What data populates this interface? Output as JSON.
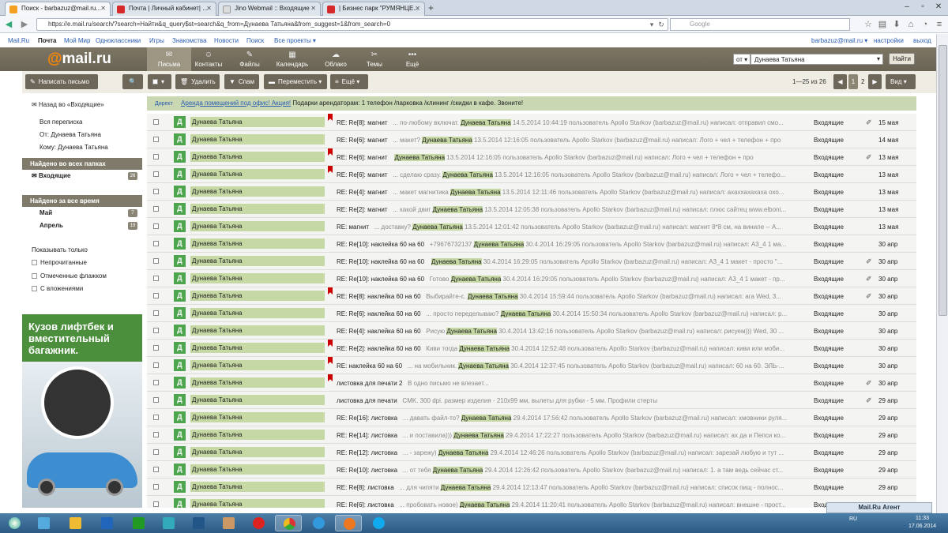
{
  "browser": {
    "tabs": [
      {
        "title": "Поиск - barbazuz@mail.ru...",
        "icon": "mailru-favicon"
      },
      {
        "title": "Почта | Личный кабинет| ...",
        "icon": "p-favicon"
      },
      {
        "title": "Jino Webmail :: Входящие",
        "icon": "jino-favicon"
      },
      {
        "title": "| Бизнес парк \"РУМЯНЦЕ...",
        "icon": "p-favicon"
      }
    ],
    "url": "https://e.mail.ru/search/?search=Найти&q_query$st=search&q_from=Дунаева Татьяна&from_suggest=1&from_search=0",
    "search_placeholder": "Google"
  },
  "toplinks": {
    "left": [
      "Mail.Ru",
      "Почта",
      "Мой Мир",
      "Одноклассники",
      "Игры",
      "Знакомства",
      "Новости",
      "Поиск",
      "Все проекты ▾"
    ],
    "account": "barbazuz@mail.ru ▾",
    "settings": "настройки",
    "logout": "выход"
  },
  "header": {
    "logo": "mail.ru",
    "nav": [
      "Письма",
      "Контакты",
      "Файлы",
      "Календарь",
      "Облако",
      "Темы",
      "Ещё"
    ],
    "search_scope": "от",
    "search_value": "Дунаева Татьяна",
    "search_button": "Найти"
  },
  "toolbar": {
    "compose": "Написать письмо",
    "delete": "Удалить",
    "spam": "Спам",
    "move": "Переместить",
    "more": "Ещё",
    "range": "1—25 из 26",
    "page1": "1",
    "page2": "2",
    "view": "Вид"
  },
  "sidebar": {
    "back": "Назад во «Входящие»",
    "links": [
      "Вся переписка",
      "От: Дунаева Татьяна",
      "Кому: Дунаева Татьяна"
    ],
    "found_all_folders": "Найдено во всех папках",
    "inbox": "Входящие",
    "inbox_count": "26",
    "found_all_time": "Найдено за все время",
    "months": [
      {
        "label": "Май",
        "count": "7"
      },
      {
        "label": "Апрель",
        "count": "19"
      }
    ],
    "show_only": "Показывать только",
    "filters": [
      "Непрочитанные",
      "Отмеченные флажком",
      "С вложениями"
    ]
  },
  "ad": {
    "headline": "Кузов лифтбек и вместительный багажник."
  },
  "direct": {
    "label": "Директ",
    "link": "Аренда помещений под офис! Акция!",
    "text": " Подарки арендаторам: 1 телефон /парковка /клининг /скидки в кафе. Звоните!"
  },
  "messages": [
    {
      "sender": "Дунаева Татьяна",
      "flag": true,
      "subject": "RE: Re[8]: магнит",
      "pre": "... по-любому включат.",
      "hl": "Дунаева Татьяна",
      "post": " 14.5.2014 10:44:19 пользователь Apollo Starkov (barbazuz@mail.ru) написал: отправил смо...",
      "folder": "Входящие",
      "clip": true,
      "date": "15 мая"
    },
    {
      "sender": "Дунаева Татьяна",
      "flag": false,
      "subject": "RE: Re[6]: магнит",
      "pre": "... макет?",
      "hl": "Дунаева Татьяна",
      "post": " 13.5.2014 12:16:05 пользователь Apollo Starkov (barbazuz@mail.ru) написал: Лого + чел + телефон + про",
      "folder": "Входящие",
      "clip": false,
      "date": "14 мая"
    },
    {
      "sender": "Дунаева Татьяна",
      "flag": true,
      "subject": "RE: Re[6]: магнит",
      "pre": "",
      "hl": "Дунаева Татьяна",
      "post": " 13.5.2014 12:16:05 пользователь Apollo Starkov (barbazuz@mail.ru) написал: Лого + чел + телефон + про",
      "folder": "Входящие",
      "clip": true,
      "date": "13 мая"
    },
    {
      "sender": "Дунаева Татьяна",
      "flag": true,
      "subject": "RE: Re[6]: магнит",
      "pre": "... сделаю сразу.",
      "hl": "Дунаева Татьяна",
      "post": " 13.5.2014 12:16:05 пользователь Apollo Starkov (barbazuz@mail.ru) написал: Лого + чел + телефо...",
      "folder": "Входящие",
      "clip": false,
      "date": "13 мая"
    },
    {
      "sender": "Дунаева Татьяна",
      "flag": false,
      "subject": "RE: Re[4]: магнит",
      "pre": "... макет магнитика",
      "hl": "Дунаева Татьяна",
      "post": " 13.5.2014 12:11:46 пользователь Apollo Starkov (barbazuz@mail.ru) написал: ахахха​хахаха охо...",
      "folder": "Входящие",
      "clip": false,
      "date": "13 мая"
    },
    {
      "sender": "Дунаева Татьяна",
      "flag": false,
      "subject": "RE: Re[2]: магнит",
      "pre": "... какой двиг",
      "hl": "Дунаева Татьяна",
      "post": " 13.5.2014 12:05:38 пользователь Apollo Starkov (barbazuz@mail.ru) написал: плюс сайтец www.elboni...",
      "folder": "Входящие",
      "clip": false,
      "date": "13 мая"
    },
    {
      "sender": "Дунаева Татьяна",
      "flag": false,
      "subject": "RE: магнит",
      "pre": "... доставку?",
      "hl": "Дунаева Татьяна",
      "post": " 13.5.2014 12:01:42 пользователь Apollo Starkov (barbazuz@mail.ru) написал: магнит 8*8 см, на виниле -- А...",
      "folder": "Входящие",
      "clip": false,
      "date": "13 мая"
    },
    {
      "sender": "Дунаева Татьяна",
      "flag": false,
      "subject": "RE: Re[10]: наклейка 60 на 60",
      "pre": "+79676732137",
      "hl": "Дунаева Татьяна",
      "post": " 30.4.2014 16:29:05 пользователь Apollo Starkov (barbazuz@mail.ru) написал: А3_4 1 ма...",
      "folder": "Входящие",
      "clip": false,
      "date": "30 апр"
    },
    {
      "sender": "Дунаева Татьяна",
      "flag": false,
      "subject": "RE: Re[10]: наклейка 60 на 60",
      "pre": "",
      "hl": "Дунаева Татьяна",
      "post": " 30.4.2014 16:29:05 пользователь Apollo Starkov (barbazuz@mail.ru) написал: А3_4 1 макет - просто \"...",
      "folder": "Входящие",
      "clip": true,
      "date": "30 апр"
    },
    {
      "sender": "Дунаева Татьяна",
      "flag": false,
      "subject": "RE: Re[10]: наклейка 60 на 60",
      "pre": "Готово",
      "hl": "Дунаева Татьяна",
      "post": " 30.4.2014 16:29:05 пользователь Apollo Starkov (barbazuz@mail.ru) написал: А3_4 1 макет - пр...",
      "folder": "Входящие",
      "clip": true,
      "date": "30 апр"
    },
    {
      "sender": "Дунаева Татьяна",
      "flag": true,
      "subject": "RE: Re[8]: наклейка 60 на 60",
      "pre": "Выбирайте-с.",
      "hl": "Дунаева Татьяна",
      "post": " 30.4.2014 15:59:44 пользователь Apollo Starkov (barbazuz@mail.ru) написал: ага Wed, 3...",
      "folder": "Входящие",
      "clip": true,
      "date": "30 апр"
    },
    {
      "sender": "Дунаева Татьяна",
      "flag": false,
      "subject": "RE: Re[6]: наклейка 60 на 60",
      "pre": "... просто переделываю?",
      "hl": "Дунаева Татьяна",
      "post": " 30.4.2014 15:50:34 пользователь Apollo Starkov (barbazuz@mail.ru) написал: р...",
      "folder": "Входящие",
      "clip": false,
      "date": "30 апр"
    },
    {
      "sender": "Дунаева Татьяна",
      "flag": false,
      "subject": "RE: Re[4]: наклейка 60 на 60",
      "pre": "Рисую",
      "hl": "Дунаева Татьяна",
      "post": " 30.4.2014 13:42:16 пользователь Apollo Starkov (barbazuz@mail.ru) написал: рисуем))) Wed, 30 ...",
      "folder": "Входящие",
      "clip": false,
      "date": "30 апр"
    },
    {
      "sender": "Дунаева Татьяна",
      "flag": true,
      "subject": "RE: Re[2]: наклейка 60 на 60",
      "pre": "Киви тогда",
      "hl": "Дунаева Татьяна",
      "post": " 30.4.2014 12:52:48 пользователь Apollo Starkov (barbazuz@mail.ru) написал: киви или моби...",
      "folder": "Входящие",
      "clip": false,
      "date": "30 апр"
    },
    {
      "sender": "Дунаева Татьяна",
      "flag": true,
      "subject": "RE: наклейка 60 на 60",
      "pre": "... на мобильник.",
      "hl": "Дунаева Татьяна",
      "post": " 30.4.2014 12:37:45 пользователь Apollo Starkov (barbazuz@mail.ru) написал: 60 на 60. ЭЛЬ-...",
      "folder": "Входящие",
      "clip": false,
      "date": "30 апр"
    },
    {
      "sender": "Дунаева Татьяна",
      "flag": true,
      "subject": "листовка для печати 2",
      "pre": "В одно письмо не влезает...",
      "hl": "",
      "post": "",
      "folder": "Входящие",
      "clip": true,
      "date": "30 апр"
    },
    {
      "sender": "Дунаева Татьяна",
      "flag": false,
      "subject": "листовка для печати",
      "pre": "CMK. 300 dpi. размер изделия - 210x99 мм, вылеты для рубки - 5 мм. Профили стерты",
      "hl": "",
      "post": "",
      "folder": "Входящие",
      "clip": true,
      "date": "29 апр"
    },
    {
      "sender": "Дунаева Татьяна",
      "flag": false,
      "subject": "RE: Re[16]: листовка",
      "pre": "... давать файл-то?",
      "hl": "Дунаева Татьяна",
      "post": " 29.4.2014 17:56:42 пользователь Apollo Starkov (barbazuz@mail.ru) написал: хмовники руля...",
      "folder": "Входящие",
      "clip": false,
      "date": "29 апр"
    },
    {
      "sender": "Дунаева Татьяна",
      "flag": false,
      "subject": "RE: Re[14]: листовка",
      "pre": "... и поставила)))",
      "hl": "Дунаева Татьяна",
      "post": " 29.4.2014 17:22:27 пользователь Apollo Starkov (barbazuz@mail.ru) написал: ах да и Пепси ко...",
      "folder": "Входящие",
      "clip": false,
      "date": "29 апр"
    },
    {
      "sender": "Дунаева Татьяна",
      "flag": false,
      "subject": "RE: Re[12]: листовка",
      "pre": "... - зарежу)",
      "hl": "Дунаева Татьяна",
      "post": " 29.4.2014 12:46:26 пользователь Apollo Starkov (barbazuz@mail.ru) написал: зарезай любую и тут ...",
      "folder": "Входящие",
      "clip": false,
      "date": "29 апр"
    },
    {
      "sender": "Дунаева Татьяна",
      "flag": false,
      "subject": "RE: Re[10]: листовка",
      "pre": "... от тебя",
      "hl": "Дунаева Татьяна",
      "post": " 29.4.2014 12:26:42 пользователь Apollo Starkov (barbazuz@mail.ru) написал: 1. а там ведь сейчас ст...",
      "folder": "Входящие",
      "clip": false,
      "date": "29 апр"
    },
    {
      "sender": "Дунаева Татьяна",
      "flag": false,
      "subject": "RE: Re[8]: листовка",
      "pre": "... для чипяти",
      "hl": "Дунаева Татьяна",
      "post": " 29.4.2014 12:13:47 пользователь Apollo Starkov (barbazuz@mail.ru) написал: список пищ - полнос...",
      "folder": "Входящие",
      "clip": false,
      "date": "29 апр"
    },
    {
      "sender": "Дунаева Татьяна",
      "flag": false,
      "subject": "RE: Re[6]: листовка",
      "pre": "... пробовать новое)",
      "hl": "Дунаева Татьяна",
      "post": " 29.4.2014 11:20:41 пользователь Apollo Starkov (barbazuz@mail.ru) написал: внешне - прост...",
      "folder": "Входящие",
      "clip": false,
      "date": "29 апр"
    }
  ],
  "avatar_letter": "Д",
  "agent": "Mail.Ru Агент",
  "taskbar": {
    "lang": "RU",
    "time": "11:33",
    "date": "17.06.2014"
  }
}
